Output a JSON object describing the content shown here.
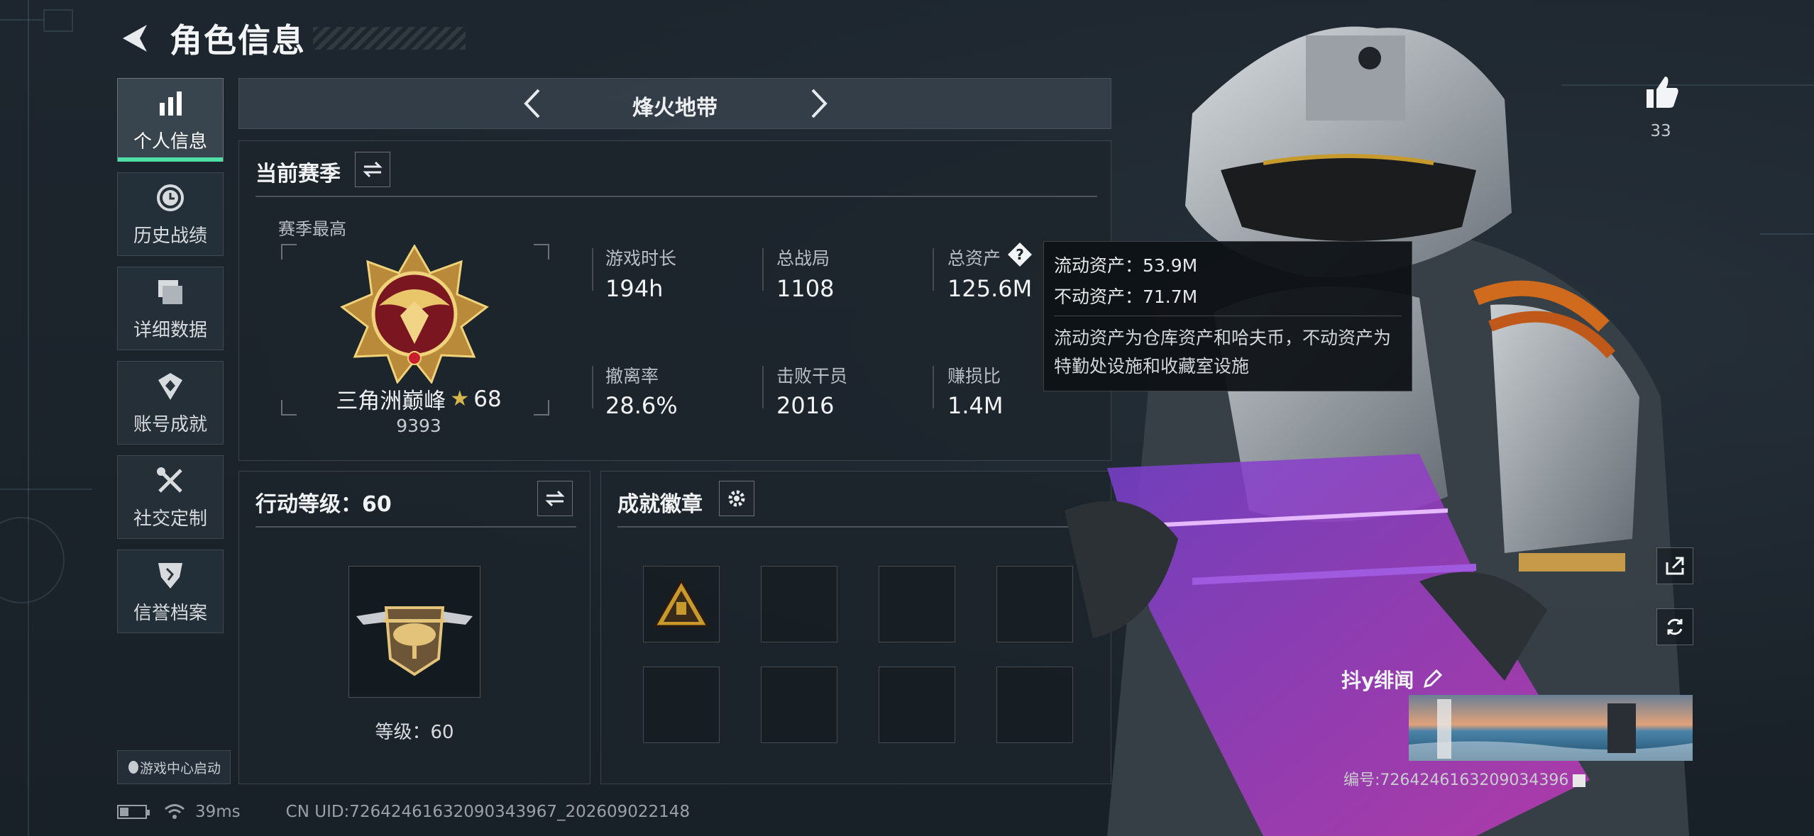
{
  "header": {
    "title": "角色信息"
  },
  "nav": {
    "items": [
      {
        "label": "个人信息",
        "icon": "bar-chart-icon",
        "active": true
      },
      {
        "label": "历史战绩",
        "icon": "history-clock-icon",
        "active": false
      },
      {
        "label": "详细数据",
        "icon": "folder-icon",
        "active": false
      },
      {
        "label": "账号成就",
        "icon": "achievement-icon",
        "active": false
      },
      {
        "label": "社交定制",
        "icon": "tools-icon",
        "active": false
      },
      {
        "label": "信誉档案",
        "icon": "shield-icon",
        "active": false
      }
    ],
    "game_center_label": "游戏中心启动"
  },
  "mode": {
    "label": "烽火地带"
  },
  "season": {
    "title": "当前赛季",
    "subtitle": "赛季最高",
    "rank_name": "三角洲巅峰",
    "rank_stars": "68",
    "rank_score": "9393",
    "stats": [
      {
        "label": "游戏时长",
        "value": "194h"
      },
      {
        "label": "总战局",
        "value": "1108"
      },
      {
        "label": "总资产",
        "value": "125.6M"
      },
      {
        "label": "撤离率",
        "value": "28.6%"
      },
      {
        "label": "击败干员",
        "value": "2016"
      },
      {
        "label": "赚损比",
        "value": "1.4M"
      }
    ]
  },
  "tooltip": {
    "line1": "流动资产：53.9M",
    "line2": "不动资产：71.7M",
    "desc": "流动资产为仓库资产和哈夫币，不动资产为特勤处设施和收藏室设施"
  },
  "action_level": {
    "title": "行动等级：60",
    "level_text": "等级：60"
  },
  "badges": {
    "title": "成就徽章"
  },
  "right": {
    "like_count": "33",
    "card_name": "抖y绯闻",
    "card_id": "编号:7264246163209034396"
  },
  "status": {
    "ping": "39ms",
    "uid": "CN UID:7264246163209034396​7_202609022148"
  },
  "colors": {
    "accent": "#4fe0a8",
    "gold": "#d9b64d"
  }
}
